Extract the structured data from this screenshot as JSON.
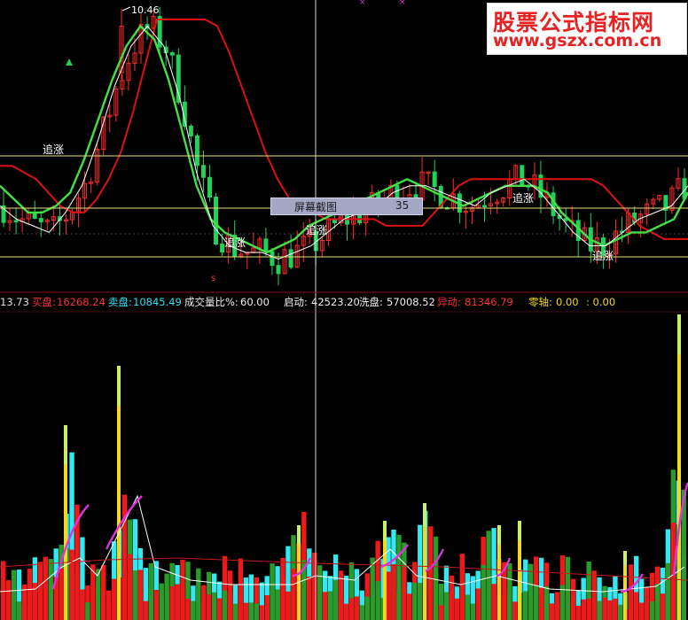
{
  "watermark": {
    "line1": "股票公式指标网",
    "line2": "www.gszx.com.cn"
  },
  "tooltip": {
    "label": "屏幕截图",
    "value": "35"
  },
  "price_panel": {
    "high_label": "10.46",
    "signal_label": "追涨",
    "signal_labels": [
      "追涨",
      "追涨",
      "追涨",
      "追涨",
      "追涨"
    ]
  },
  "indicator_legend": {
    "value_prefix": "13.73",
    "buy_label": "买盘:",
    "buy_value": "16268.24",
    "sell_label": "卖盘:",
    "sell_value": "10845.49",
    "ratio_label": "成交量比%:",
    "ratio_value": "60.00",
    "start_label": "启动:",
    "start_value": "42523.20",
    "wash_label": "洗盘:",
    "wash_value": "57008.52",
    "anomaly_label": "异动:",
    "anomaly_value": "81346.79",
    "zero_label": "零轴:",
    "zero_value": "0.00",
    "zero_value2": ": 0.00"
  },
  "colors": {
    "background": "#000000",
    "up": "#ff2a2a",
    "down": "#22d15a",
    "red_line": "#dd1111",
    "green_line": "#44e044",
    "white_line": "#ffffff",
    "guide_line": "#e8e07a",
    "bar_cyan": "#33e8f0",
    "bar_red": "#f01818",
    "bar_green": "#2a9a2a",
    "bar_yellow": "#f2d81e",
    "bar_lime": "#c8f060",
    "magenta_line": "#e030e0"
  },
  "chart_data": [
    {
      "type": "line",
      "title": "",
      "grid": false,
      "series": [
        {
          "values": [
            8.1,
            8.1,
            8.0,
            7.9,
            7.7,
            7.5,
            7.4,
            7.4,
            7.6,
            7.9,
            8.3,
            8.9,
            9.6,
            10.3,
            10.3,
            10.3,
            10.3,
            10.3,
            10.2,
            9.8,
            9.3,
            8.8,
            8.3,
            7.9,
            7.6,
            7.4,
            7.4,
            7.3,
            7.3,
            7.3,
            7.3,
            7.3,
            7.2,
            7.2,
            7.2,
            7.2,
            7.4,
            7.6,
            7.8,
            7.9,
            7.9,
            7.9,
            7.9,
            7.9,
            7.9,
            7.9,
            7.9,
            7.9,
            7.9,
            7.9,
            7.8,
            7.6,
            7.4,
            7.2,
            7.1,
            7.0,
            7.0,
            7.0
          ]
        },
        {
          "values": [
            7.8,
            7.6,
            7.4,
            7.4,
            7.5,
            7.7,
            8.2,
            8.8,
            9.4,
            9.9,
            10.2,
            10.0,
            9.4,
            8.6,
            7.8,
            7.3,
            7.1,
            7.0,
            6.9,
            6.8,
            6.9,
            7.0,
            7.2,
            7.3,
            7.4,
            7.5,
            7.6,
            7.7,
            7.8,
            7.9,
            7.8,
            7.7,
            7.6,
            7.5,
            7.6,
            7.7,
            7.8,
            7.8,
            7.8,
            7.7,
            7.4,
            7.2,
            7.0,
            6.9,
            7.0,
            7.1,
            7.1,
            7.2,
            7.3,
            7.7
          ]
        },
        {
          "values": [
            7.5,
            7.3,
            7.2,
            7.1,
            7.4,
            7.8,
            8.5,
            9.3,
            9.9,
            10.2,
            9.9,
            9.1,
            8.0,
            7.2,
            6.9,
            6.8,
            6.8,
            6.7,
            6.8,
            6.9,
            7.1,
            7.3,
            7.4,
            7.5,
            7.7,
            7.8,
            7.8,
            7.7,
            7.6,
            7.5,
            7.7,
            7.8,
            7.9,
            7.7,
            7.4,
            7.1,
            6.9,
            6.9,
            7.1,
            7.3,
            7.4,
            7.5,
            7.8
          ]
        }
      ]
    },
    {
      "type": "bar",
      "title": "",
      "series": [
        {
          "name": "买盘",
          "values": [
            16268.24
          ]
        },
        {
          "name": "卖盘",
          "values": [
            10845.49
          ]
        },
        {
          "name": "启动",
          "values": [
            42523.2
          ]
        },
        {
          "name": "洗盘",
          "values": [
            57008.52
          ]
        },
        {
          "name": "异动",
          "values": [
            81346.79
          ]
        }
      ]
    }
  ]
}
